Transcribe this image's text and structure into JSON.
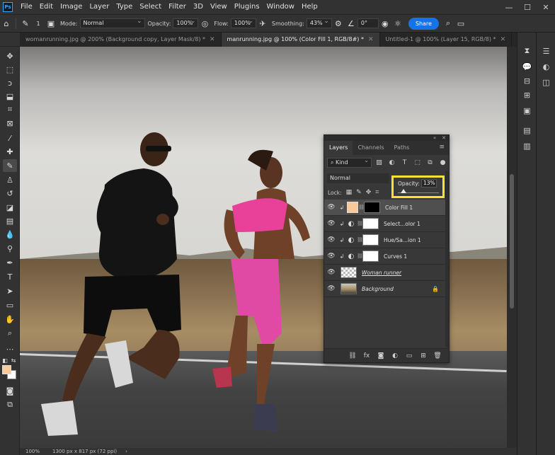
{
  "app": {
    "logo": "Ps"
  },
  "menu": [
    "File",
    "Edit",
    "Image",
    "Layer",
    "Type",
    "Select",
    "Filter",
    "3D",
    "View",
    "Plugins",
    "Window",
    "Help"
  ],
  "window_controls": {
    "minimize": "—",
    "maximize": "☐",
    "close": "✕"
  },
  "options": {
    "mode_label": "Mode:",
    "mode_value": "Normal",
    "opacity_label": "Opacity:",
    "opacity_value": "100%",
    "flow_label": "Flow:",
    "flow_value": "100%",
    "smoothing_label": "Smoothing:",
    "smoothing_value": "43%",
    "angle_value": "0°",
    "brush_size": "1",
    "share_label": "Share"
  },
  "tabs": [
    {
      "label": "womanrunning.jpg @ 200% (Background copy, Layer Mask/8) *",
      "active": false
    },
    {
      "label": "manrunning.jpg @ 100% (Color Fill 1, RGB/8#) *",
      "active": true
    },
    {
      "label": "Untitled-1 @ 100% (Layer 15, RGB/8) *",
      "active": false
    }
  ],
  "status": {
    "zoom": "100%",
    "doc_info": "1300 px x 817 px (72 ppi)",
    "arrow": "›"
  },
  "layers_panel": {
    "tabs": [
      "Layers",
      "Channels",
      "Paths"
    ],
    "collapse": "«",
    "close": "✕",
    "kind_label": "Kind",
    "blend_mode": "Normal",
    "opacity_label": "Opacity:",
    "opacity_value": "13%",
    "opacity_fraction": 0.13,
    "lock_label": "Lock:",
    "layers": [
      {
        "name": "Color Fill 1",
        "selected": true
      },
      {
        "name": "Select...olor 1",
        "selected": false
      },
      {
        "name": "Hue/Sa...ion 1",
        "selected": false
      },
      {
        "name": "Curves 1",
        "selected": false
      },
      {
        "name": "Woman runner",
        "selected": false
      },
      {
        "name": "Background",
        "selected": false
      }
    ]
  },
  "colors": {
    "foreground": "#f7c99b",
    "background": "#ffffff",
    "accent": "#1473e6",
    "highlight": "#ffe033"
  }
}
